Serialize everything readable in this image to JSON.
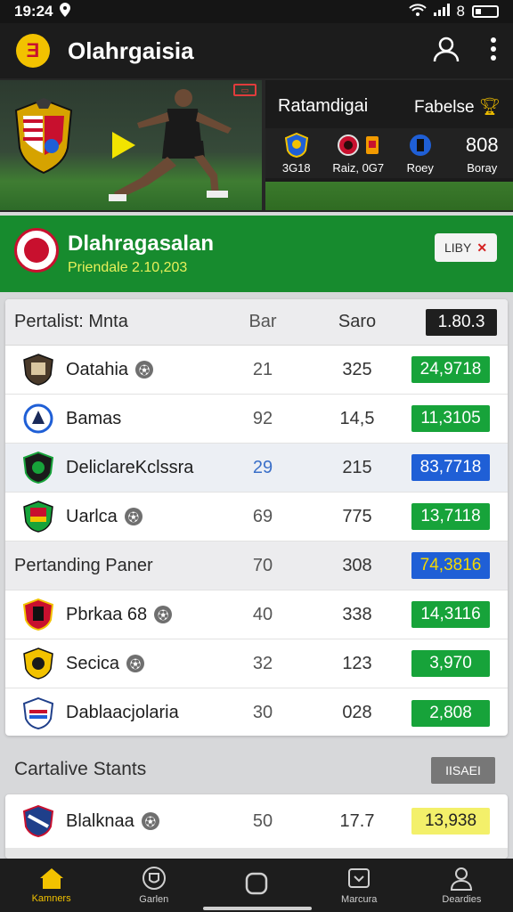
{
  "status": {
    "time": "19:24",
    "battery": "8"
  },
  "app": {
    "title": "Olahrgaisia"
  },
  "hero": {
    "left_title": "Ratamdigai",
    "right_title": "Fabelse",
    "stats": [
      {
        "label": "3G18"
      },
      {
        "label": "Raiz, 0G7"
      },
      {
        "value": "808",
        "label": "Roey"
      },
      {
        "label": "Boray"
      }
    ]
  },
  "league": {
    "name": "Dlahragasalan",
    "subtitle": "Priendale 2.10,203",
    "button_label": "LIBY"
  },
  "table": {
    "header": {
      "title": "Pertalist: Mnta",
      "col_a": "Bar",
      "col_b": "Saro",
      "col_c": "1.80.3"
    },
    "rows": [
      {
        "type": "team",
        "name": "Oatahia",
        "a": "21",
        "b": "325",
        "c": "24,9718",
        "color": "green"
      },
      {
        "type": "team",
        "name": "Bamas",
        "a": "92",
        "b": "14,5",
        "c": "11,3105",
        "color": "green"
      },
      {
        "type": "team",
        "name": "DeliclareKclssra",
        "a": "29",
        "b": "215",
        "c": "83,7718",
        "color": "blue"
      },
      {
        "type": "team",
        "name": "Uarlca",
        "a": "69",
        "b": "775",
        "c": "13,7118",
        "color": "green"
      },
      {
        "type": "section",
        "name": "Pertanding Paner",
        "a": "70",
        "b": "308",
        "c": "74,3816",
        "color": "blue-gold"
      },
      {
        "type": "team",
        "name": "Pbrkaa 68",
        "a": "40",
        "b": "338",
        "c": "14,3116",
        "color": "green"
      },
      {
        "type": "team",
        "name": "Secica",
        "a": "32",
        "b": "123",
        "c": "3,970",
        "color": "green"
      },
      {
        "type": "team",
        "name": "Dablaacjolaria",
        "a": "30",
        "b": "028",
        "c": "2,808",
        "color": "green"
      }
    ]
  },
  "second": {
    "title": "Cartalive Stants",
    "badge": "IISAEI",
    "row": {
      "name": "Blalknaa",
      "a": "50",
      "b": "17.7",
      "c": "13,938"
    }
  },
  "nav": {
    "items": [
      {
        "label": "Kamners",
        "icon": "home-icon"
      },
      {
        "label": "Garlen",
        "icon": "shield-icon"
      },
      {
        "label": "",
        "icon": "square-icon"
      },
      {
        "label": "Marcura",
        "icon": "inbox-icon"
      },
      {
        "label": "Deardies",
        "icon": "profile-icon"
      }
    ]
  },
  "colors": {
    "green": "#17a33a",
    "blue": "#1f5fd6",
    "yellow": "#f3f06a",
    "header_green": "#178b2e",
    "accent": "#f2c200"
  }
}
